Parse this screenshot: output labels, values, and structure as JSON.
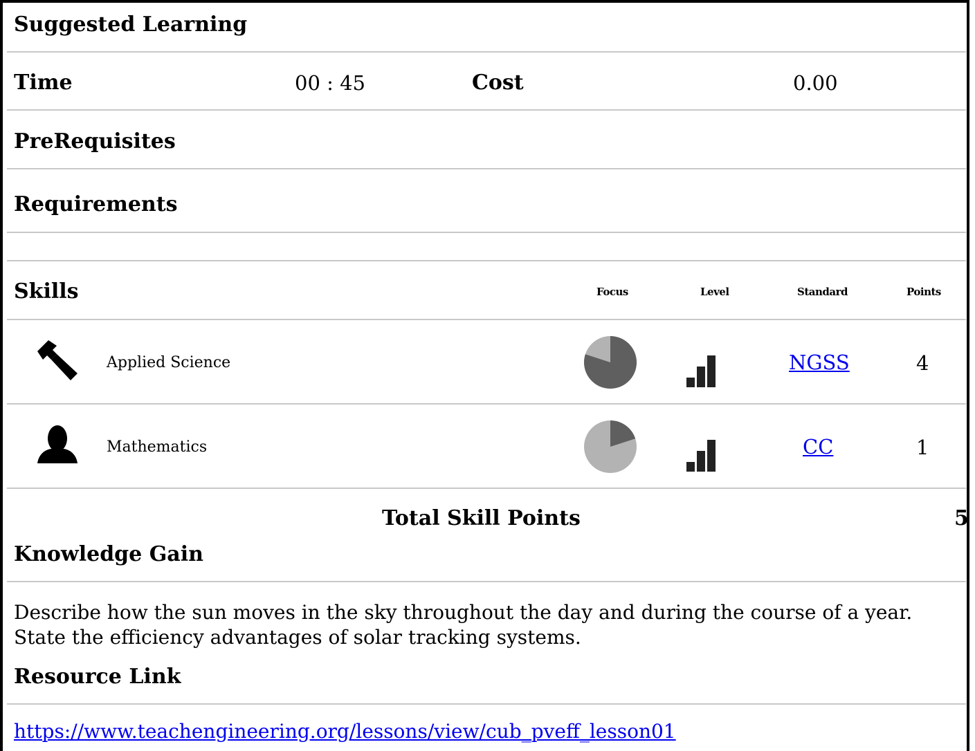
{
  "title": "Suggested Learning",
  "time": {
    "label": "Time",
    "value": "00 : 45"
  },
  "cost": {
    "label": "Cost",
    "value": "0.00"
  },
  "prerequisites": {
    "label": "PreRequisites"
  },
  "requirements": {
    "label": "Requirements"
  },
  "skills": {
    "label": "Skills",
    "columns": {
      "focus": "Focus",
      "level": "Level",
      "standard": "Standard",
      "points": "Points"
    },
    "rows": [
      {
        "icon": "hammer-icon",
        "name": "Applied Science",
        "focus": 0.8,
        "level": "3 of 3",
        "standard": "NGSS",
        "points": "4"
      },
      {
        "icon": "person-icon",
        "name": "Mathematics",
        "focus": 0.2,
        "level": "3 of 3",
        "standard": "CC",
        "points": "1"
      }
    ],
    "total_label": "Total Skill Points",
    "total_value": "5"
  },
  "knowledge": {
    "label": "Knowledge Gain",
    "lines": [
      "Describe how the sun moves in the sky throughout the day and during the course of a year.",
      "State the efficiency advantages of solar tracking systems."
    ]
  },
  "resource": {
    "label": "Resource Link",
    "url": "https://www.teachengineering.org/lessons/view/cub_pveff_lesson01"
  },
  "colors": {
    "pie_dark": "#5f5f5f",
    "pie_light": "#b3b3b3",
    "link": "#0000ee",
    "divider": "#c8c8c8"
  }
}
